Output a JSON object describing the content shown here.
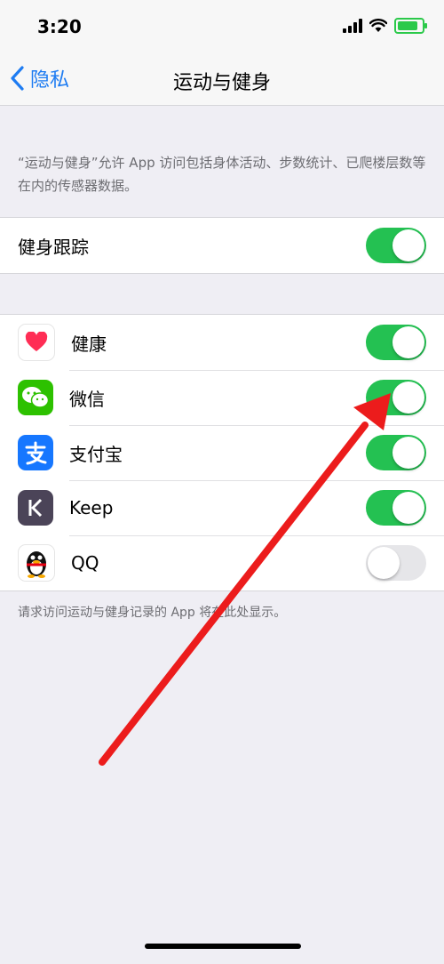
{
  "status_bar": {
    "time": "3:20",
    "icons": [
      "signal-icon",
      "wifi-icon",
      "battery-charging-icon"
    ]
  },
  "nav": {
    "back_label": "隐私",
    "title": "运动与健身"
  },
  "description": "“运动与健身”允许 App 访问包括身体活动、步数统计、已爬楼层数等在内的传感器数据。",
  "fitness_tracking": {
    "label": "健身跟踪",
    "enabled": true
  },
  "apps": [
    {
      "name": "健康",
      "icon": "health-heart-icon",
      "enabled": true
    },
    {
      "name": "微信",
      "icon": "wechat-icon",
      "enabled": true
    },
    {
      "name": "支付宝",
      "icon": "alipay-icon",
      "enabled": true
    },
    {
      "name": "Keep",
      "icon": "keep-icon",
      "enabled": true
    },
    {
      "name": "QQ",
      "icon": "qq-penguin-icon",
      "enabled": false
    }
  ],
  "footer_note": "请求访问运动与健身记录的 App 将在此处显示。",
  "colors": {
    "accent": "#1e7cf2",
    "toggle_on": "#24c152",
    "arrow": "#ec1c1c"
  }
}
